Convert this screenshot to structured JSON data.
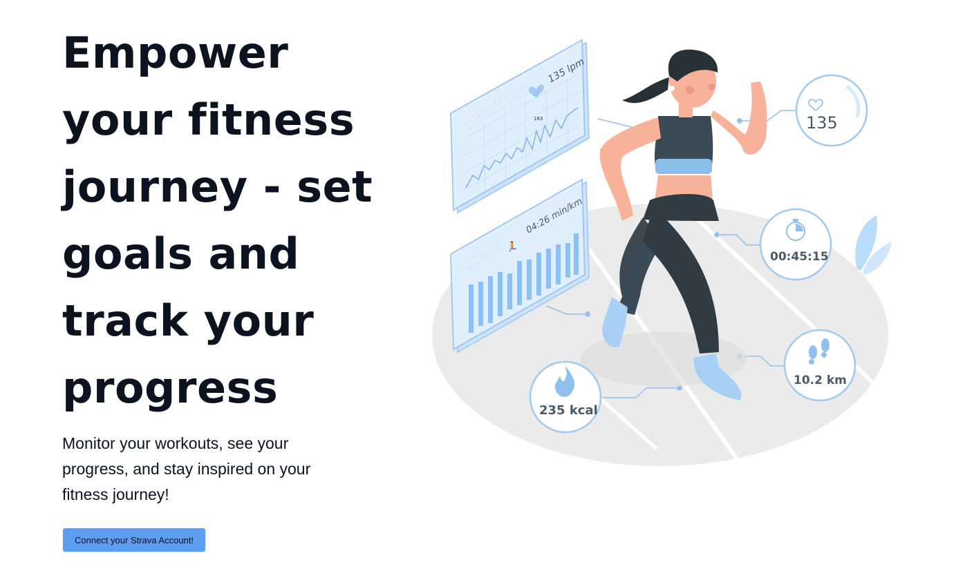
{
  "hero": {
    "headline_lines": [
      "Empower",
      "your fitness",
      "journey - set",
      "goals and",
      "track your",
      "progress"
    ],
    "subtitle": "Monitor your workouts, see your progress, and stay inspired on your fitness journey!",
    "cta_label": "Connect your Strava Account!"
  },
  "illustration": {
    "heart_panel_title": "Heart rate",
    "heart_panel_value": "135 lpm",
    "heart_chart_label": "163",
    "speed_panel_title": "Speed",
    "speed_panel_value": "04:26 min/km",
    "heart_badge_value": "135",
    "timer_badge_value": "00:45:15",
    "distance_badge_value": "10.2 km",
    "calories_badge_value": "235 kcal"
  },
  "colors": {
    "accent": "#5b9ef2",
    "panel_fill": "#d7e9fb",
    "panel_stroke": "#9cc6f0",
    "badge_stroke": "#9fcbf2",
    "skin": "#f8b29a",
    "outfit": "#3b4a55",
    "track": "#ebebeb"
  }
}
